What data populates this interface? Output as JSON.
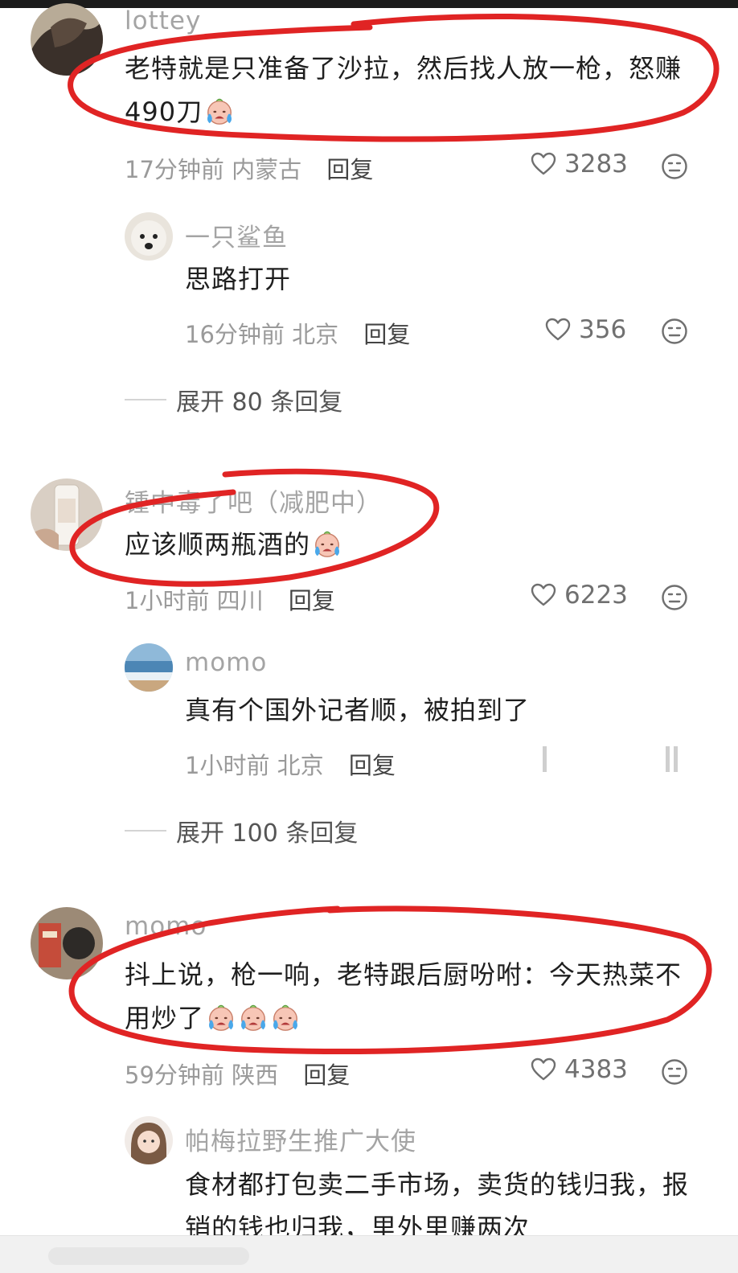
{
  "comments": [
    {
      "username": "lottey",
      "text": "老特就是只准备了沙拉，然后找人放一枪，怒赚490刀",
      "time": "17分钟前",
      "location": "内蒙古",
      "reply_label": "回复",
      "likes": "3283",
      "reply": {
        "username": "一只鲨鱼",
        "text": "思路打开",
        "time": "16分钟前",
        "location": "北京",
        "reply_label": "回复",
        "likes": "356"
      },
      "expand_label": "展开 80 条回复"
    },
    {
      "username": "锺中毒了吧（减肥中）",
      "text": "应该顺两瓶酒的",
      "time": "1小时前",
      "location": "四川",
      "reply_label": "回复",
      "likes": "6223",
      "reply": {
        "username": "momo",
        "text": "真有个国外记者顺，被拍到了",
        "time": "1小时前",
        "location": "北京",
        "reply_label": "回复"
      },
      "expand_label": "展开 100 条回复"
    },
    {
      "username": "momo",
      "text": "抖上说，枪一响，老特跟后厨吩咐：今天热菜不用炒了",
      "time": "59分钟前",
      "location": "陕西",
      "reply_label": "回复",
      "likes": "4383",
      "reply": {
        "username": "帕梅拉野生推广大使",
        "text": "食材都打包卖二手市场，卖货的钱归我，报销的钱也归我，里外里赚两次"
      }
    }
  ],
  "colors": {
    "annotation_red": "#e02424",
    "text_primary": "#1f1f1f",
    "text_secondary": "#9a9a9a"
  },
  "icons": [
    "heart-icon",
    "dislike-face-icon",
    "crying-emoji-icon"
  ]
}
